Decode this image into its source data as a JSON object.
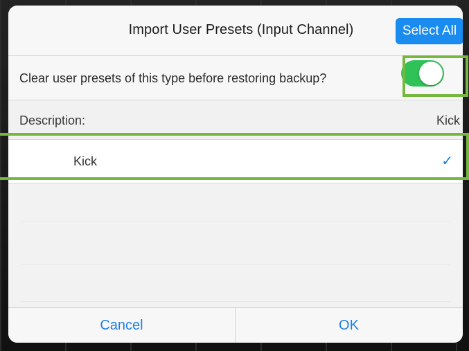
{
  "dialog": {
    "title": "Import User Presets (Input Channel)",
    "select_all_label": "Select All"
  },
  "options": {
    "clear_label": "Clear user presets of this type before restoring backup?",
    "clear_toggle_on": true
  },
  "description": {
    "label": "Description:",
    "value": "Kick"
  },
  "presets": [
    {
      "label": "Kick",
      "selected": true,
      "check_icon": "checkmark-icon"
    }
  ],
  "footer": {
    "cancel_label": "Cancel",
    "ok_label": "OK"
  },
  "colors": {
    "accent": "#1a8cf0",
    "toggle_on": "#2fc257",
    "highlight": "#76b83f"
  }
}
